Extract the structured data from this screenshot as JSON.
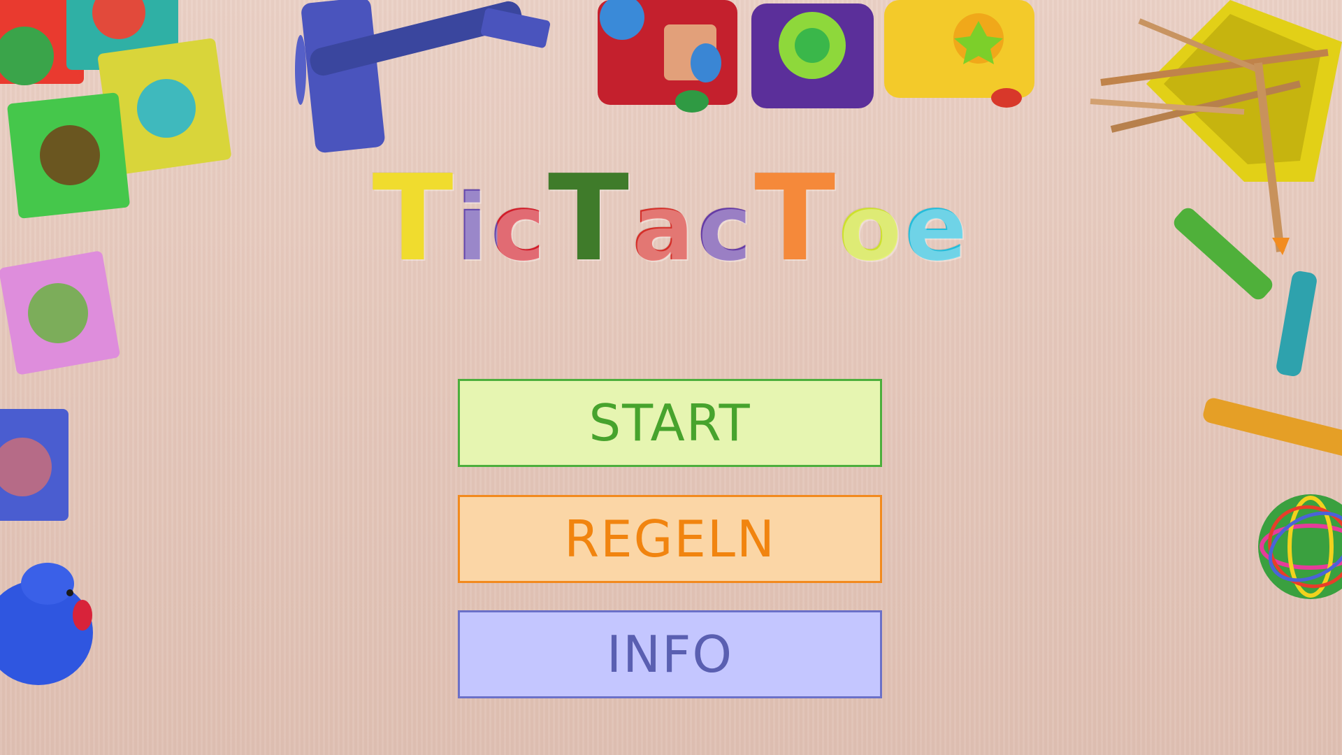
{
  "title": {
    "letters": [
      "T",
      "ic",
      "T",
      "ac",
      "T",
      "oe"
    ]
  },
  "menu": {
    "start_label": "START",
    "rules_label": "REGELN",
    "info_label": "INFO"
  },
  "colors": {
    "title_t1": "#f0dc2e",
    "title_i": "#6a4bb6",
    "title_c": "#dd1f2c",
    "title_t2": "#3f7b2a",
    "title_a": "#e0322c",
    "title_c2": "#6b3fae",
    "title_t3": "#f5893a",
    "title_o": "#d9ec2f",
    "title_e": "#25c7e6",
    "start_bg": "#e6f5b1",
    "rules_bg": "#fbd6a6",
    "info_bg": "#c4c6ff"
  },
  "decorations": [
    "foam-puzzle-mat",
    "toy-airplane",
    "toy-train",
    "pencil-cup",
    "crayons",
    "yarn-ball",
    "rubber-duck"
  ]
}
